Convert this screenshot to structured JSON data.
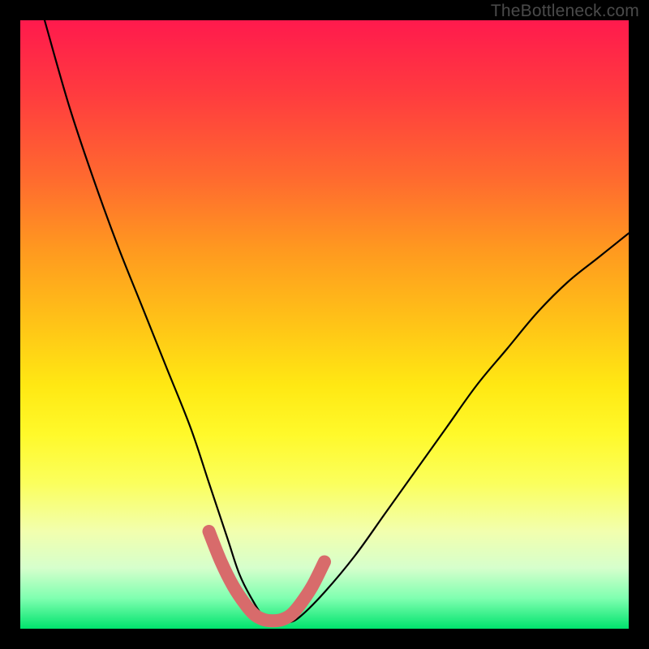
{
  "watermark": "TheBottleneck.com",
  "chart_data": {
    "type": "line",
    "title": "",
    "xlabel": "",
    "ylabel": "",
    "xlim": [
      0,
      100
    ],
    "ylim": [
      0,
      100
    ],
    "series": [
      {
        "name": "bottleneck-curve",
        "x": [
          4,
          8,
          12,
          16,
          20,
          24,
          28,
          31,
          34,
          36,
          38,
          40,
          42,
          44,
          46,
          50,
          55,
          60,
          65,
          70,
          75,
          80,
          85,
          90,
          95,
          100
        ],
        "values": [
          100,
          86,
          74,
          63,
          53,
          43,
          33,
          24,
          15,
          9,
          5,
          2,
          1,
          1,
          2,
          6,
          12,
          19,
          26,
          33,
          40,
          46,
          52,
          57,
          61,
          65
        ]
      },
      {
        "name": "optimal-zone-marker",
        "x": [
          31,
          33,
          35,
          37,
          38.5,
          40,
          41.5,
          43,
          44.5,
          46,
          48,
          50
        ],
        "values": [
          16,
          11,
          7,
          4,
          2.3,
          1.5,
          1.3,
          1.5,
          2.3,
          4,
          7,
          11
        ]
      }
    ],
    "colors": {
      "curve": "#000000",
      "marker": "#d86b6b",
      "background_top": "#ff1a4d",
      "background_bottom": "#00e36d"
    }
  }
}
